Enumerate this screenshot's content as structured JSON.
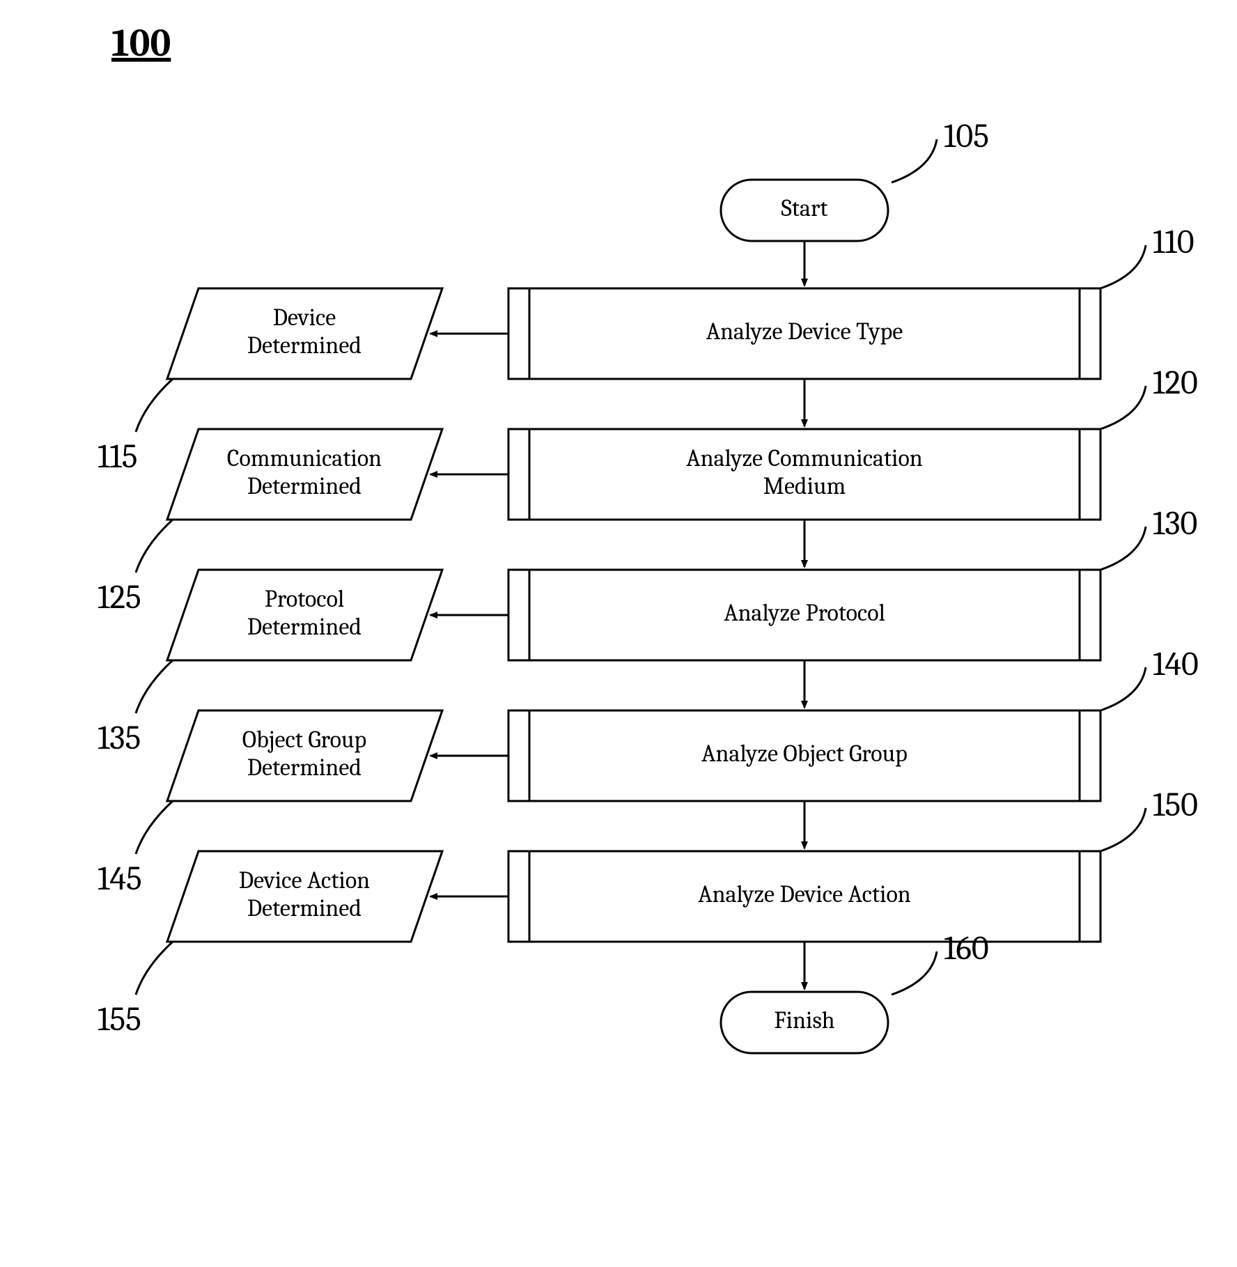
{
  "figure_ref": "100",
  "terminals": {
    "start": {
      "label": "Start",
      "ref": "105"
    },
    "finish": {
      "label": "Finish",
      "ref": "160"
    }
  },
  "steps": [
    {
      "process": {
        "label": "Analyze Device Type",
        "ref": "110"
      },
      "data": {
        "line1": "Device",
        "line2": "Determined",
        "ref": "115"
      }
    },
    {
      "process": {
        "line1": "Analyze Communication",
        "line2": "Medium",
        "ref": "120"
      },
      "data": {
        "line1": "Communication",
        "line2": "Determined",
        "ref": "125"
      }
    },
    {
      "process": {
        "label": "Analyze Protocol",
        "ref": "130"
      },
      "data": {
        "line1": "Protocol",
        "line2": "Determined",
        "ref": "135"
      }
    },
    {
      "process": {
        "label": "Analyze Object Group",
        "ref": "140"
      },
      "data": {
        "line1": "Object Group",
        "line2": "Determined",
        "ref": "145"
      }
    },
    {
      "process": {
        "label": "Analyze Device Action",
        "ref": "150"
      },
      "data": {
        "line1": "Device Action",
        "line2": "Determined",
        "ref": "155"
      }
    }
  ]
}
